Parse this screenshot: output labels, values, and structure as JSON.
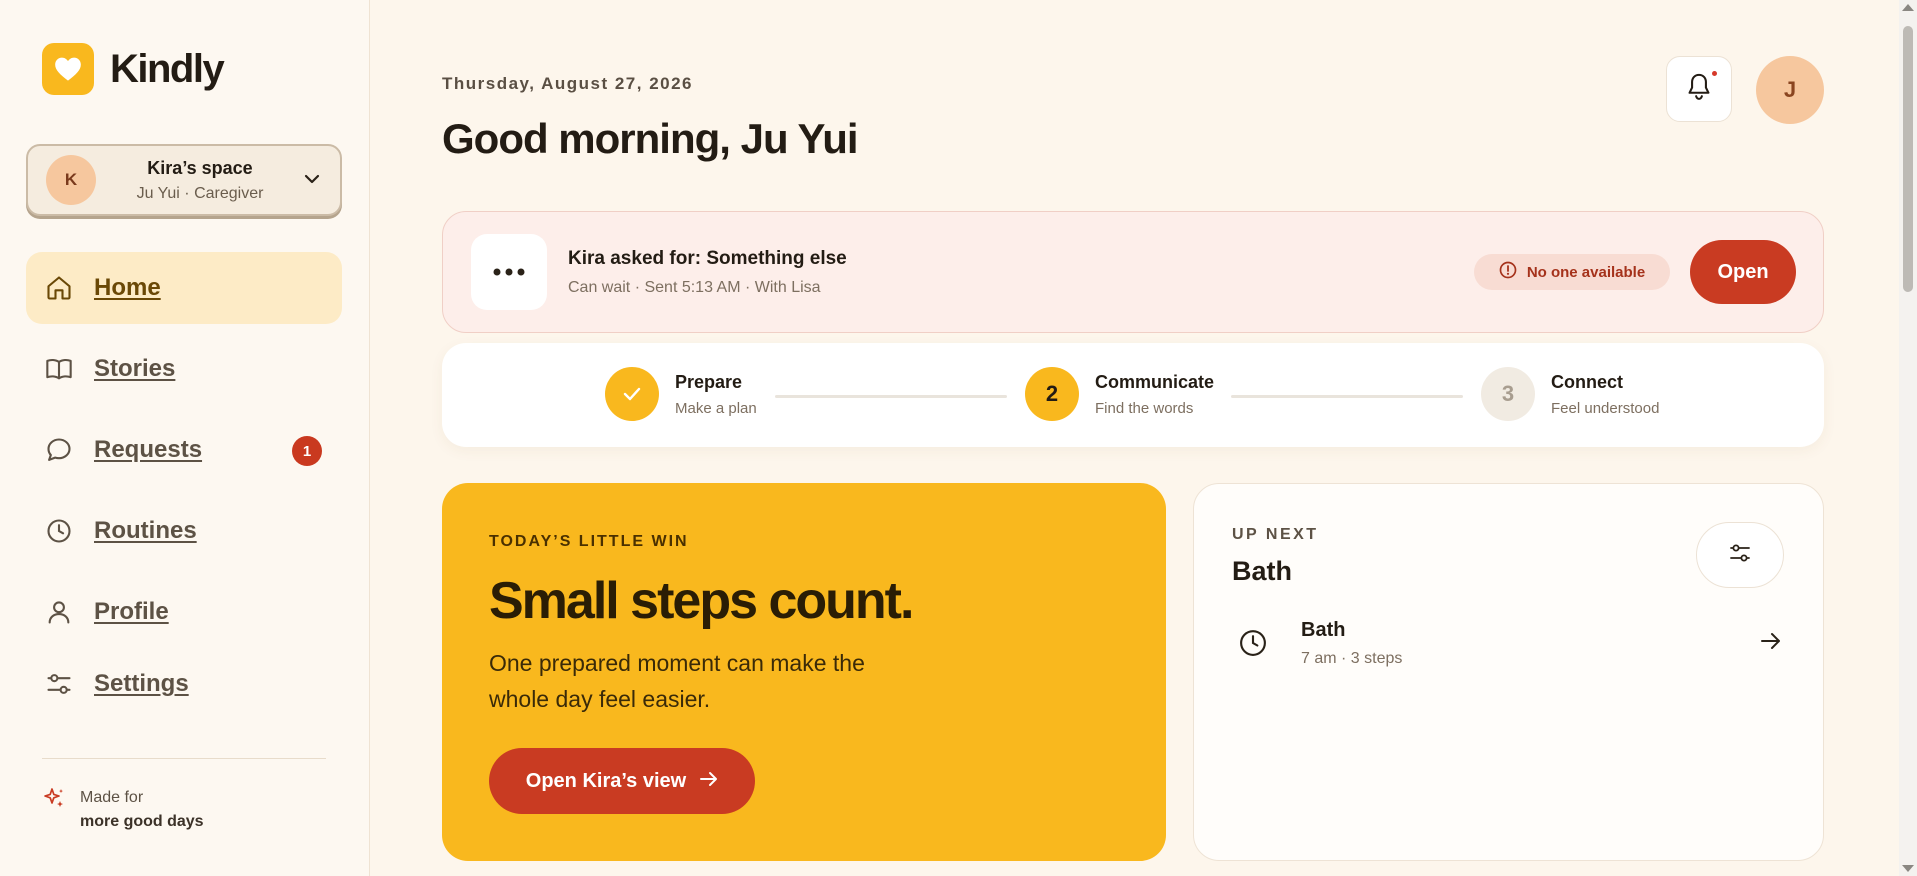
{
  "app": {
    "name": "Kindly",
    "accent": "#f9b81e",
    "danger": "#c93b22"
  },
  "space": {
    "avatar_letter": "K",
    "name": "Kira’s space",
    "role": "Ju Yui · Caregiver"
  },
  "nav": [
    {
      "label": "Home",
      "icon": "home-icon",
      "active": true
    },
    {
      "label": "Stories",
      "icon": "book-icon"
    },
    {
      "label": "Requests",
      "icon": "chat-bubble-icon",
      "badge": "1"
    },
    {
      "label": "Routines",
      "icon": "clock-icon"
    },
    {
      "label": "Profile",
      "icon": "person-icon"
    },
    {
      "label": "Settings",
      "icon": "sliders-icon"
    }
  ],
  "footer": {
    "line1": "Made for",
    "line2": "more good days",
    "icon": "sparkle-icon"
  },
  "header": {
    "date": "Thursday, August 27, 2026",
    "greeting": "Good morning, Ju Yui",
    "user_initial": "J"
  },
  "request": {
    "title": "Kira asked for: Something else",
    "meta": "Can wait · Sent 5:13 AM · With Lisa",
    "status": "No one available",
    "action": "Open"
  },
  "steps": [
    {
      "number": "1",
      "title": "Prepare",
      "subtitle": "Make a plan",
      "state": "done"
    },
    {
      "number": "2",
      "title": "Communicate",
      "subtitle": "Find the words",
      "state": "current"
    },
    {
      "number": "3",
      "title": "Connect",
      "subtitle": "Feel understood",
      "state": "future"
    }
  ],
  "win": {
    "eyebrow": "TODAY’S LITTLE WIN",
    "title": "Small steps count.",
    "body": "One prepared moment can make the whole day feel easier.",
    "button": "Open Kira’s view"
  },
  "up_next": {
    "eyebrow": "UP NEXT",
    "title": "Bath",
    "items": [
      {
        "name": "Bath",
        "meta": "7 am · 3 steps"
      }
    ]
  }
}
